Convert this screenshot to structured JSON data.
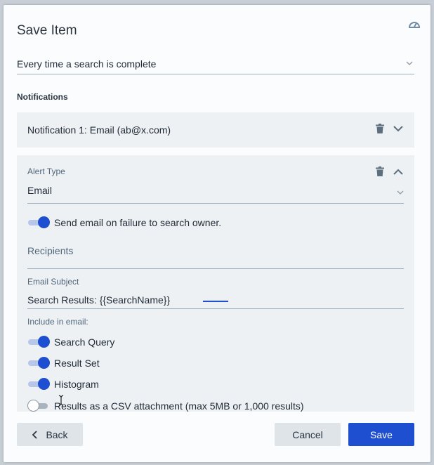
{
  "dialog": {
    "title": "Save Item",
    "header_icon": "dashboard-gauge-icon"
  },
  "frequency": {
    "value": "Every time a search is complete",
    "icon": "chevron-down-icon"
  },
  "notifications": {
    "section_label": "Notifications",
    "items": [
      {
        "label": "Notification 1: Email  (ab@x.com)",
        "expanded": false
      }
    ]
  },
  "alert_panel": {
    "alert_type_label": "Alert Type",
    "alert_type_value": "Email",
    "failure_toggle": {
      "label": "Send email on failure to search owner.",
      "on": true
    },
    "recipients_label": "Recipients",
    "email_subject_label": "Email Subject",
    "email_subject_value": "Search Results: {{SearchName}}",
    "include_label": "Include in email:",
    "include_options": [
      {
        "label": "Search Query",
        "on": true
      },
      {
        "label": "Result Set",
        "on": true
      },
      {
        "label": "Histogram",
        "on": true
      },
      {
        "label": "Results as a CSV attachment (max 5MB or 1,000 results)",
        "on": false
      }
    ]
  },
  "footer": {
    "back_label": "Back",
    "cancel_label": "Cancel",
    "save_label": "Save"
  },
  "colors": {
    "accent": "#1d4fd0",
    "panel_bg": "#eef1f4",
    "button_secondary_bg": "#dfe4e9",
    "label_color": "#51677b"
  }
}
